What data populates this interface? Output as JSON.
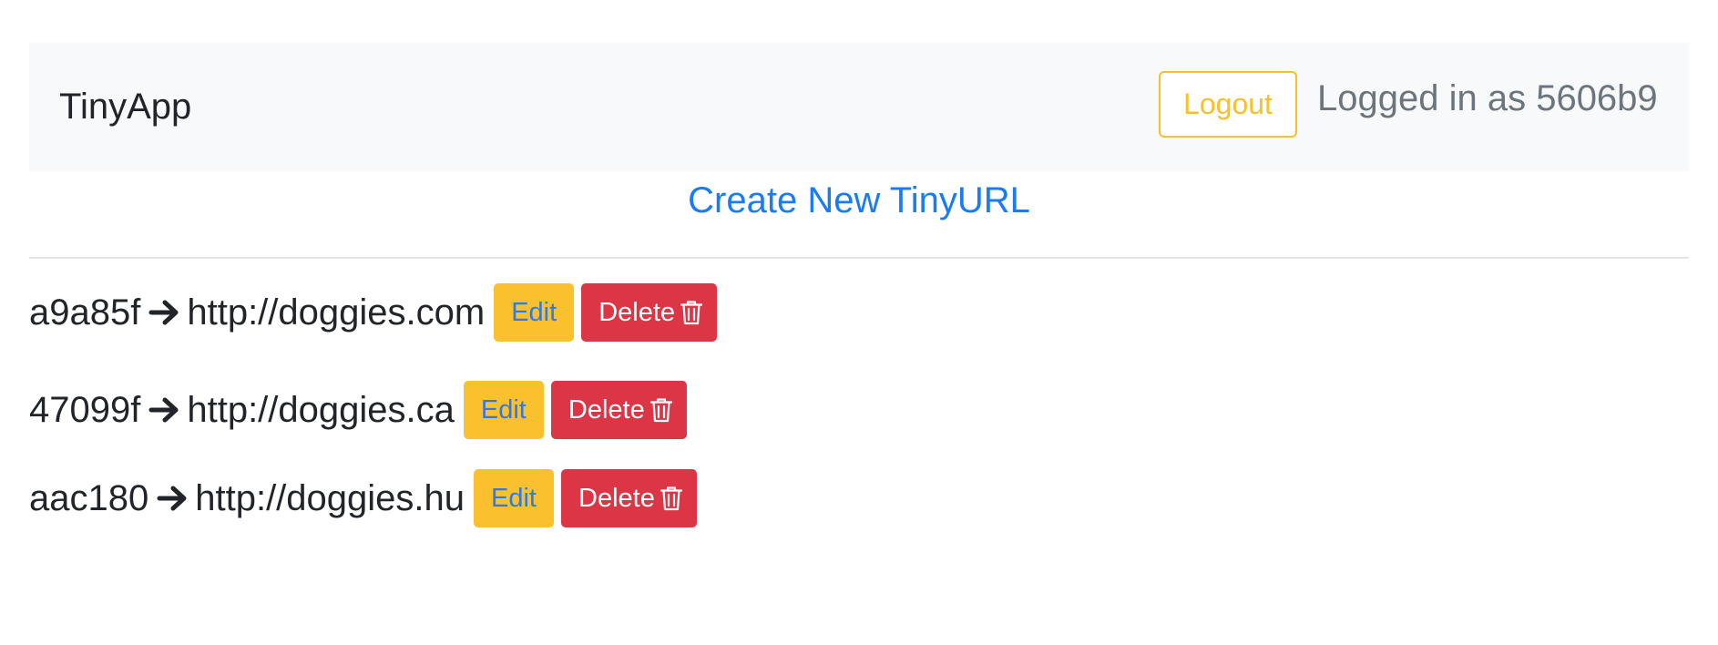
{
  "navbar": {
    "brand": "TinyApp",
    "logout_label": "Logout",
    "logged_in_text": "Logged in as 5606b9"
  },
  "main": {
    "create_link_label": "Create New TinyURL",
    "urls": [
      {
        "short_id": "a9a85f",
        "long_url": "http://doggies.com",
        "edit_label": "Edit",
        "delete_label": "Delete"
      },
      {
        "short_id": "47099f",
        "long_url": "http://doggies.ca",
        "edit_label": "Edit",
        "delete_label": "Delete"
      },
      {
        "short_id": "aac180",
        "long_url": "http://doggies.hu",
        "edit_label": "Edit",
        "delete_label": "Delete"
      }
    ]
  },
  "icons": {
    "row_arrow": "arrow-right-icon",
    "delete": "trash-icon"
  },
  "colors": {
    "navbar_bg": "#f8f9fa",
    "warning": "#fbc02d",
    "danger": "#dc3545",
    "link": "#1a7cf5",
    "muted": "#6c757d"
  }
}
